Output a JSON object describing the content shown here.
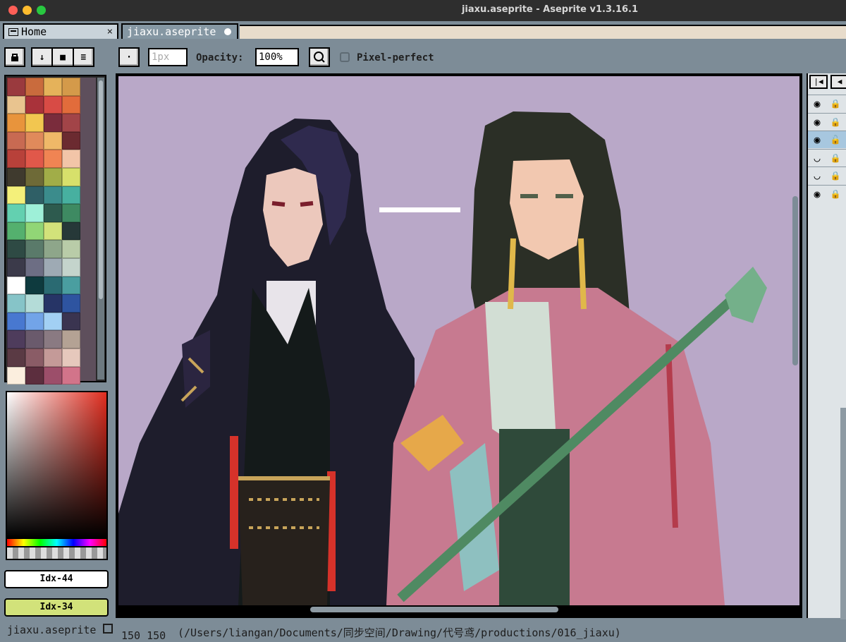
{
  "window": {
    "title": "jiaxu.aseprite - Aseprite v1.3.16.1"
  },
  "tabs": [
    {
      "label": "Home",
      "close": "×"
    },
    {
      "label": "jiaxu.aseprite"
    }
  ],
  "toolbar": {
    "brush_size_placeholder": "1px",
    "opacity_label": "Opacity:",
    "opacity_value": "100%",
    "pixel_perfect_label": "Pixel-perfect",
    "pixel_perfect_checked": false
  },
  "palette": {
    "swatches": [
      "#9a3a3e",
      "#c96b3d",
      "#e5b25a",
      "#d49a4a",
      "#e9c48f",
      "#a9323a",
      "#d84b45",
      "#e26c3b",
      "#e8943c",
      "#f2c650",
      "#7a2c3c",
      "#a24448",
      "#c86a52",
      "#e08a5b",
      "#efb868",
      "#6b2a30",
      "#b8413a",
      "#e1584a",
      "#f08453",
      "#f2c5a8",
      "#3f3a2e",
      "#6e6a37",
      "#a1ad48",
      "#d7e06b",
      "#f4f07a",
      "#2f5f66",
      "#3b8c8c",
      "#47b0a0",
      "#63d0b0",
      "#9ef0d8",
      "#2d5a4e",
      "#3e8a62",
      "#54b06e",
      "#91d676",
      "#d2e27a",
      "#263838",
      "#2e4a44",
      "#5a7a6a",
      "#8ea68a",
      "#b9cca8",
      "#3b3a4a",
      "#6d6e84",
      "#9eaab4",
      "#c4d4cc",
      "#ffffff",
      "#0e3a3e",
      "#2a6a72",
      "#4a9ea0",
      "#86c4c8",
      "#b4dcd8",
      "#263466",
      "#2e54a0",
      "#4878d0",
      "#72a4e8",
      "#a2d0f4",
      "#3a3450",
      "#4e3c5c",
      "#6a5a6c",
      "#8a7a82",
      "#b4a294",
      "#5a3a44",
      "#8a5c66",
      "#c49a98",
      "#e6c8bc",
      "#fbeede",
      "#5c2e3e",
      "#9c4e6a",
      "#d2748a"
    ]
  },
  "colors": {
    "foreground": "Idx-44",
    "background": "Idx-34",
    "canvas_bg": "#b9a8c8"
  },
  "timeline": {
    "layers": [
      {
        "visible": true,
        "locked": true
      },
      {
        "visible": true,
        "locked": true
      },
      {
        "visible": true,
        "locked": false,
        "selected": true
      },
      {
        "visible": false,
        "locked": true
      },
      {
        "visible": false,
        "locked": true
      },
      {
        "visible": true,
        "locked": true
      }
    ]
  },
  "status": {
    "filename": "jiaxu.aseprite",
    "position": "150  150",
    "path": "(/Users/liangan/Documents/同步空间/Drawing/代号鸢/productions/016_jiaxu)"
  }
}
